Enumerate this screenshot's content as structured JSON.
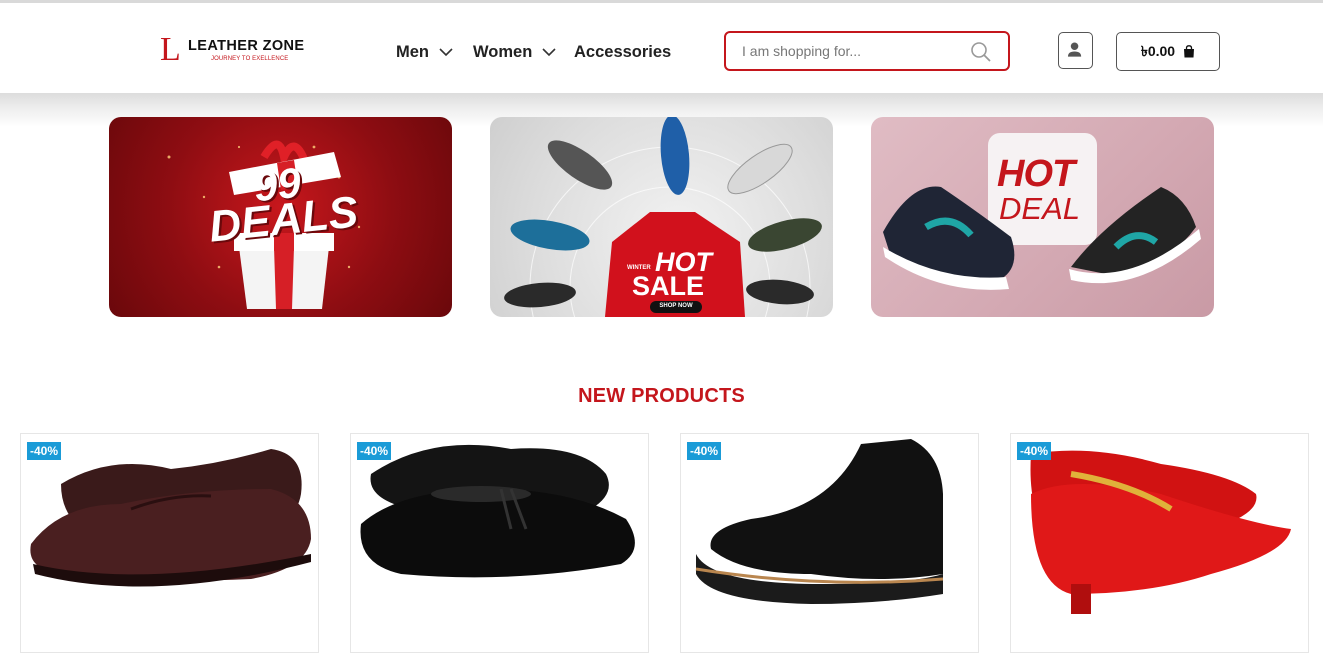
{
  "brand": {
    "name": "LEATHER ZONE",
    "tagline": "JOURNEY TO EXELLENCE",
    "mark": "L"
  },
  "nav": {
    "items": [
      {
        "label": "Men",
        "has_dropdown": true
      },
      {
        "label": "Women",
        "has_dropdown": true
      },
      {
        "label": "Accessories",
        "has_dropdown": false
      }
    ]
  },
  "search": {
    "placeholder": "I am shopping for...",
    "value": ""
  },
  "cart": {
    "total": "৳0.00"
  },
  "banners": [
    {
      "line1": "99",
      "line2": "DEALS"
    },
    {
      "line1": "HOT",
      "line2": "SALE",
      "prefix": "WINTER",
      "cta": "SHOP NOW"
    },
    {
      "line1": "HOT",
      "line2": "DEAL"
    }
  ],
  "section": {
    "title": "NEW PRODUCTS"
  },
  "products": [
    {
      "discount": "-40%"
    },
    {
      "discount": "-40%"
    },
    {
      "discount": "-40%"
    },
    {
      "discount": "-40%"
    }
  ],
  "colors": {
    "accent": "#c4161c",
    "badge": "#1a9bd7"
  }
}
